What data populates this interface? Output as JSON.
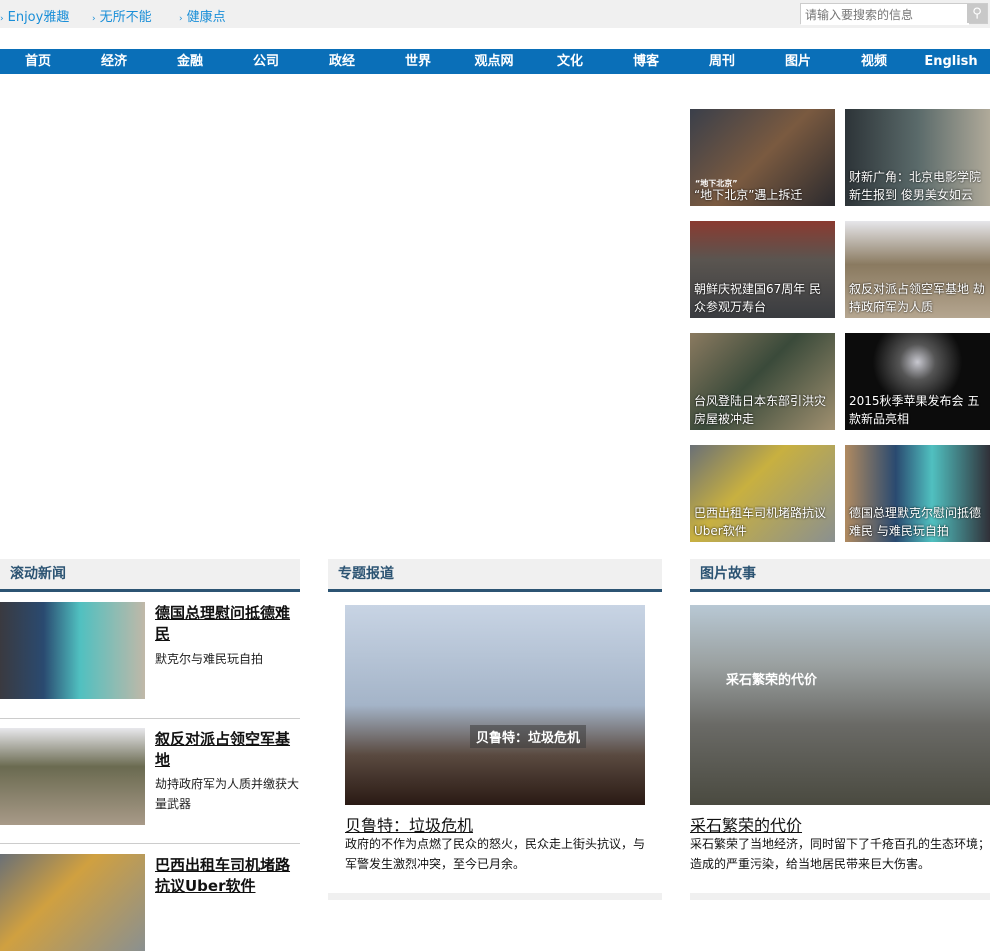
{
  "topbar": {
    "links": [
      "Enjoy雅趣",
      "无所不能",
      "健康点"
    ],
    "search_placeholder": "请输入要搜索的信息"
  },
  "nav": [
    "首页",
    "经济",
    "金融",
    "公司",
    "政经",
    "世界",
    "观点网",
    "文化",
    "博客",
    "周刊",
    "图片",
    "视频",
    "English"
  ],
  "photo_grid": [
    {
      "caption": "“地下北京”遇上拆迁",
      "img_text": "“地下北京”"
    },
    {
      "caption": "财新广角：北京电影学院新生报到 俊男美女如云"
    },
    {
      "caption": "朝鲜庆祝建国67周年 民众参观万寿台"
    },
    {
      "caption": "叙反对派占领空军基地 劫持政府军为人质"
    },
    {
      "caption": "台风登陆日本东部引洪灾 房屋被冲走"
    },
    {
      "caption": "2015秋季苹果发布会 五款新品亮相"
    },
    {
      "caption": "巴西出租车司机堵路抗议Uber软件"
    },
    {
      "caption": "德国总理默克尔慰问抵德难民 与难民玩自拍"
    }
  ],
  "rolling": {
    "title": "滚动新闻",
    "items": [
      {
        "title": "德国总理慰问抵德难民",
        "sub": "默克尔与难民玩自拍"
      },
      {
        "title": "叙反对派占领空军基地",
        "sub": "劫持政府军为人质并缴获大量武器"
      },
      {
        "title": "巴西出租车司机堵路抗议Uber软件",
        "sub": ""
      }
    ]
  },
  "special": {
    "title": "专题报道",
    "headline": "贝鲁特：垃圾危机",
    "overlay": "贝鲁特：垃圾危机",
    "desc": "政府的不作为点燃了民众的怒火，民众走上街头抗议，与军警发生激烈冲突，至今已月余。"
  },
  "photo_story": {
    "title": "图片故事",
    "headline": "采石繁荣的代价",
    "overlay": "采石繁荣的代价",
    "desc": "采石繁荣了当地经济，同时留下了千疮百孔的生态环境；造成的严重污染，给当地居民带来巨大伤害。"
  }
}
